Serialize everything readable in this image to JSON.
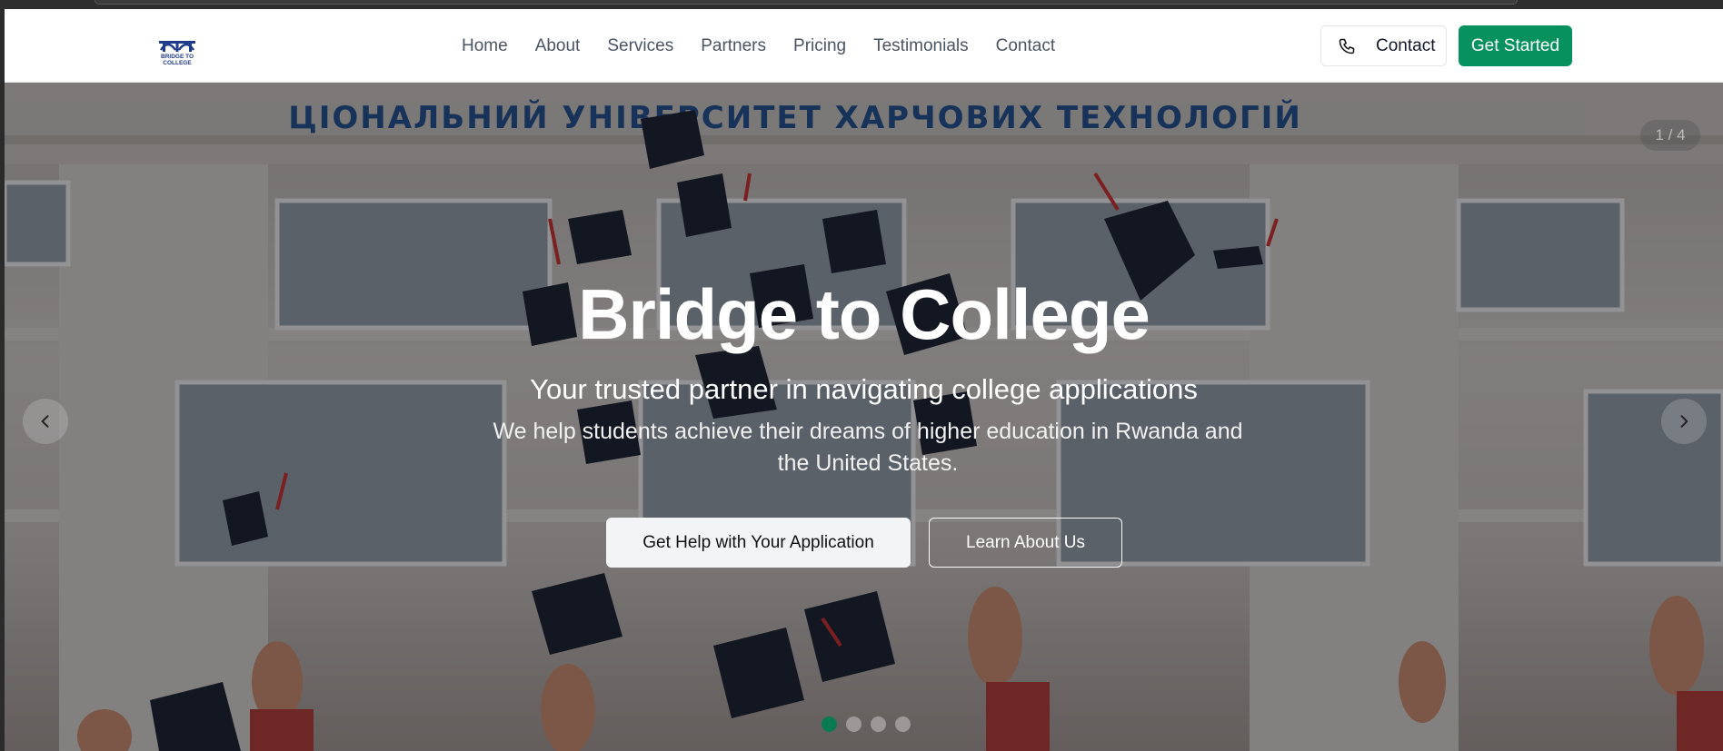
{
  "header": {
    "logo": {
      "line1": "BRIDGE TO",
      "line2": "COLLEGE"
    },
    "nav": [
      "Home",
      "About",
      "Services",
      "Partners",
      "Pricing",
      "Testimonials",
      "Contact"
    ],
    "contact_label": "Contact",
    "get_started_label": "Get Started"
  },
  "hero": {
    "counter": "1 / 4",
    "title": "Bridge to College",
    "subtitle": "Your trusted partner in navigating college applications",
    "description": "We help students achieve their dreams of higher education in Rwanda and the United States.",
    "primary_cta": "Get Help with Your Application",
    "secondary_cta": "Learn About Us",
    "slides_total": 4,
    "active_slide": 1
  },
  "colors": {
    "brand_green": "#07915f",
    "dot_active": "#0a7a52",
    "logo_blue": "#1e3a8a"
  }
}
